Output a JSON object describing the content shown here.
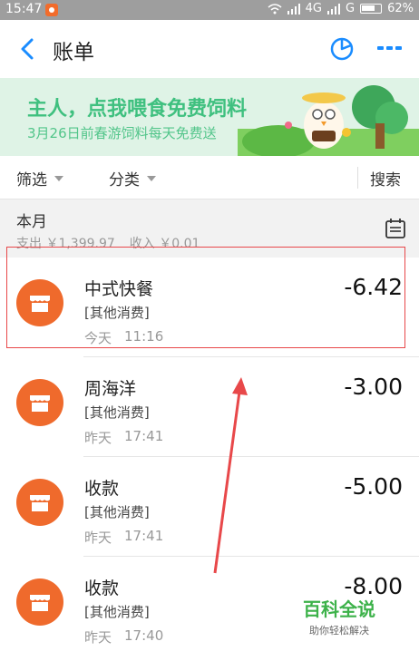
{
  "status_bar": {
    "time": "15:47",
    "network": "4G",
    "network2": "G",
    "battery": "62%"
  },
  "header": {
    "title": "账单"
  },
  "banner": {
    "headline": "主人，点我喂食免费饲料",
    "subtitle": "3月26日前春游饲料每天免费送"
  },
  "filters": {
    "filter_label": "筛选",
    "category_label": "分类",
    "search_label": "搜索"
  },
  "month": {
    "label": "本月",
    "expense": "支出 ￥1,399.97",
    "income": "收入 ￥0.01"
  },
  "transactions": [
    {
      "name": "中式快餐",
      "category": "[其他消费]",
      "day": "今天",
      "time": "11:16",
      "amount": "-6.42"
    },
    {
      "name": "周海洋",
      "category": "[其他消费]",
      "day": "昨天",
      "time": "17:41",
      "amount": "-3.00"
    },
    {
      "name": "收款",
      "category": "[其他消费]",
      "day": "昨天",
      "time": "17:41",
      "amount": "-5.00"
    },
    {
      "name": "收款",
      "category": "[其他消费]",
      "day": "昨天",
      "time": "17:40",
      "amount": "-8.00"
    }
  ],
  "watermark": {
    "main": "百科全说",
    "sub": "助你轻松解决"
  },
  "colors": {
    "accent_blue": "#1a8cff",
    "icon_orange": "#ef6a2c",
    "banner_green": "#3fc07f",
    "annotation_red": "#e8484a"
  },
  "icons": {
    "back": "chevron-left-icon",
    "chart": "pie-chart-icon",
    "more": "more-dots-icon",
    "calendar": "calendar-icon",
    "shop": "shop-icon"
  }
}
